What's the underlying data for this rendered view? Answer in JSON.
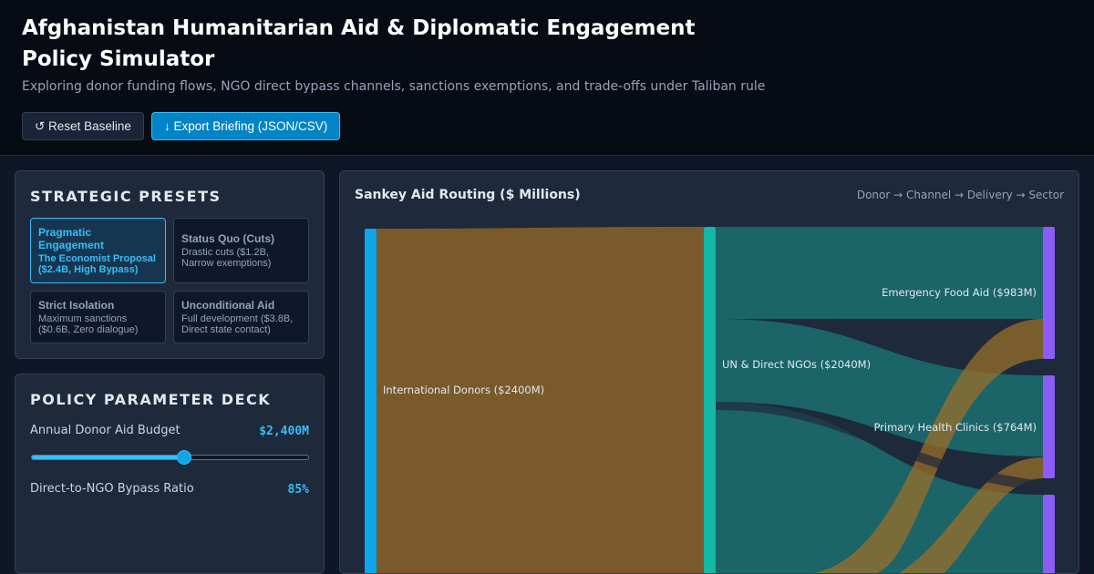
{
  "header": {
    "title": "Afghanistan Humanitarian Aid & Diplomatic Engagement Policy Simulator",
    "subtitle": "Exploring donor funding flows, NGO direct bypass channels, sanctions exemptions, and trade-offs under Taliban rule",
    "reset_label": "↺ Reset Baseline",
    "export_label": "↓ Export Briefing (JSON/CSV)"
  },
  "presets": {
    "heading": "STRATEGIC PRESETS",
    "items": [
      {
        "title": "Pragmatic Engagement",
        "desc": "The Economist Proposal ($2.4B, High Bypass)",
        "active": true
      },
      {
        "title": "Status Quo (Cuts)",
        "desc": "Drastic cuts ($1.2B, Narrow exemptions)",
        "active": false
      },
      {
        "title": "Strict Isolation",
        "desc": "Maximum sanctions ($0.6B, Zero dialogue)",
        "active": false
      },
      {
        "title": "Unconditional Aid",
        "desc": "Full development ($3.8B, Direct state contact)",
        "active": false
      }
    ]
  },
  "params": {
    "heading": "POLICY PARAMETER DECK",
    "budget_label": "Annual Donor Aid Budget",
    "budget_value": "$2,400M",
    "budget_fraction": 0.55,
    "bypass_label": "Direct-to-NGO Bypass Ratio",
    "bypass_value": "85%"
  },
  "sankey": {
    "title": "Sankey Aid Routing ($ Millions)",
    "flow_label": "Donor → Channel → Delivery → Sector",
    "colors": {
      "donor_node": "#0ea5e9",
      "channel_node": "#14b8a6",
      "sector_node": "#8b5cf6",
      "donor_link": "#7a5a2a",
      "channel_link": "#1b6468",
      "cross_link": "#9a6f2a"
    },
    "nodes": {
      "donors": "International Donors ($2400M)",
      "un_ngo": "UN & Direct NGOs ($2040M)",
      "food": "Emergency Food Aid ($983M)",
      "health": "Primary Health Clinics ($764M)"
    }
  }
}
